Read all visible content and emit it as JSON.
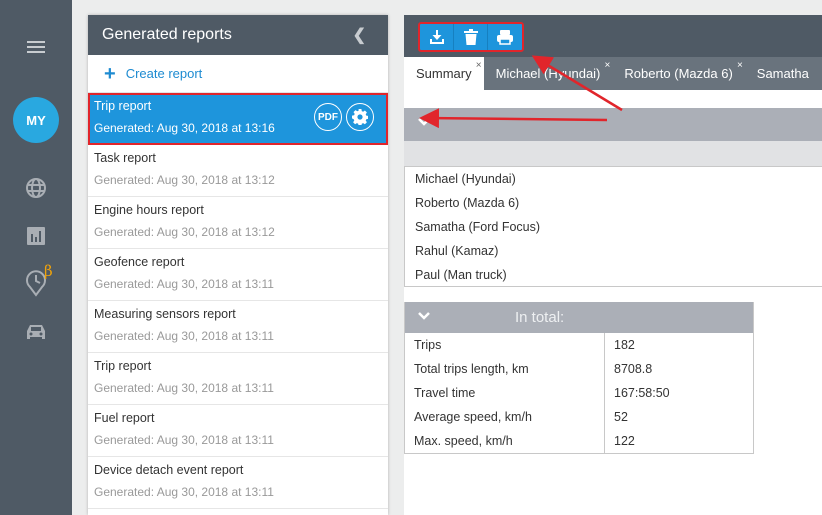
{
  "sidebar": {
    "menu_icon": "hamburger-icon",
    "avatar_initials": "MY",
    "items": [
      {
        "icon": "globe-icon",
        "label": "Map"
      },
      {
        "icon": "bar-chart-icon",
        "label": "Reports"
      },
      {
        "icon": "clock-pin-icon",
        "label": "Timeline",
        "badge": "β"
      },
      {
        "icon": "car-icon",
        "label": "Vehicles"
      }
    ],
    "beta_badge": "β",
    "accent_color": "#29a8e0"
  },
  "reports_panel": {
    "title": "Generated reports",
    "create_label": "Create report",
    "pdf_label": "PDF",
    "reports": [
      {
        "title": "Trip report",
        "generated": "Generated: Aug 30, 2018 at 13:16",
        "active": true
      },
      {
        "title": "Task report",
        "generated": "Generated: Aug 30, 2018 at 13:12"
      },
      {
        "title": "Engine hours report",
        "generated": "Generated: Aug 30, 2018 at 13:12"
      },
      {
        "title": "Geofence report",
        "generated": "Generated: Aug 30, 2018 at 13:11"
      },
      {
        "title": "Measuring sensors report",
        "generated": "Generated: Aug 30, 2018 at 13:11"
      },
      {
        "title": "Trip report",
        "generated": "Generated: Aug 30, 2018 at 13:11"
      },
      {
        "title": "Fuel report",
        "generated": "Generated: Aug 30, 2018 at 13:11"
      },
      {
        "title": "Device detach event report",
        "generated": "Generated: Aug 30, 2018 at 13:11"
      }
    ]
  },
  "toolbar": {
    "buttons": [
      {
        "icon": "download-icon",
        "label": "Download"
      },
      {
        "icon": "trash-icon",
        "label": "Delete"
      },
      {
        "icon": "print-icon",
        "label": "Print"
      }
    ]
  },
  "tabs": [
    {
      "label": "Summary",
      "active": true
    },
    {
      "label": "Michael (Hyundai)"
    },
    {
      "label": "Roberto (Mazda 6)"
    },
    {
      "label": "Samatha"
    }
  ],
  "tab_close_glyph": "×",
  "vehicles": [
    "Michael (Hyundai)",
    "Roberto (Mazda 6)",
    "Samatha (Ford Focus)",
    "Rahul (Kamaz)",
    "Paul (Man truck)"
  ],
  "totals": {
    "title": "In total:",
    "rows": [
      {
        "key": "Trips",
        "value": "182"
      },
      {
        "key": "Total trips length, km",
        "value": "8708.8"
      },
      {
        "key": "Travel time",
        "value": "167:58:50"
      },
      {
        "key": "Average speed, km/h",
        "value": "52"
      },
      {
        "key": "Max. speed, km/h",
        "value": "122"
      }
    ]
  },
  "colors": {
    "brand_blue": "#1e95dc",
    "dark_header": "#4f5a65",
    "highlight_red": "#e1252b",
    "beta_orange": "#f0a30a"
  }
}
